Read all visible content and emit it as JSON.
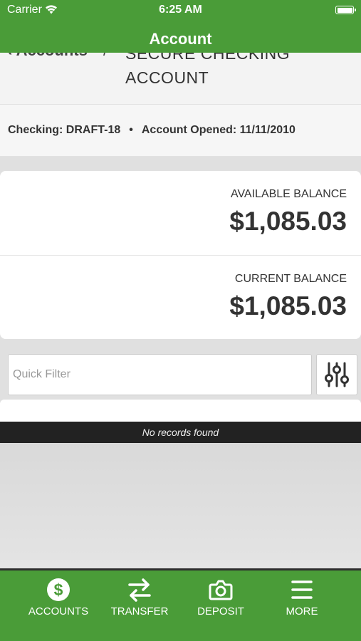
{
  "status_bar": {
    "carrier": "Carrier",
    "time": "6:25 AM"
  },
  "nav": {
    "title": "Account"
  },
  "breadcrumb": {
    "back": "‹ Accounts",
    "separator": "/",
    "current": "SECURE CHECKING ACCOUNT"
  },
  "account_info": {
    "checking": "Checking: DRAFT-18",
    "dot": "•",
    "opened": "Account Opened: 11/11/2010"
  },
  "balances": {
    "available_label": "AVAILABLE BALANCE",
    "available_value": "$1,085.03",
    "current_label": "CURRENT BALANCE",
    "current_value": "$1,085.03"
  },
  "filter": {
    "placeholder": "Quick Filter",
    "value": ""
  },
  "records": {
    "empty_message": "No records found"
  },
  "tabs": [
    {
      "label": "ACCOUNTS",
      "icon": "dollar-circle-icon"
    },
    {
      "label": "TRANSFER",
      "icon": "transfer-arrows-icon"
    },
    {
      "label": "DEPOSIT",
      "icon": "camera-icon"
    },
    {
      "label": "MORE",
      "icon": "menu-icon"
    }
  ],
  "colors": {
    "brand_green": "#4a9c38",
    "dark_bar": "#222222"
  }
}
